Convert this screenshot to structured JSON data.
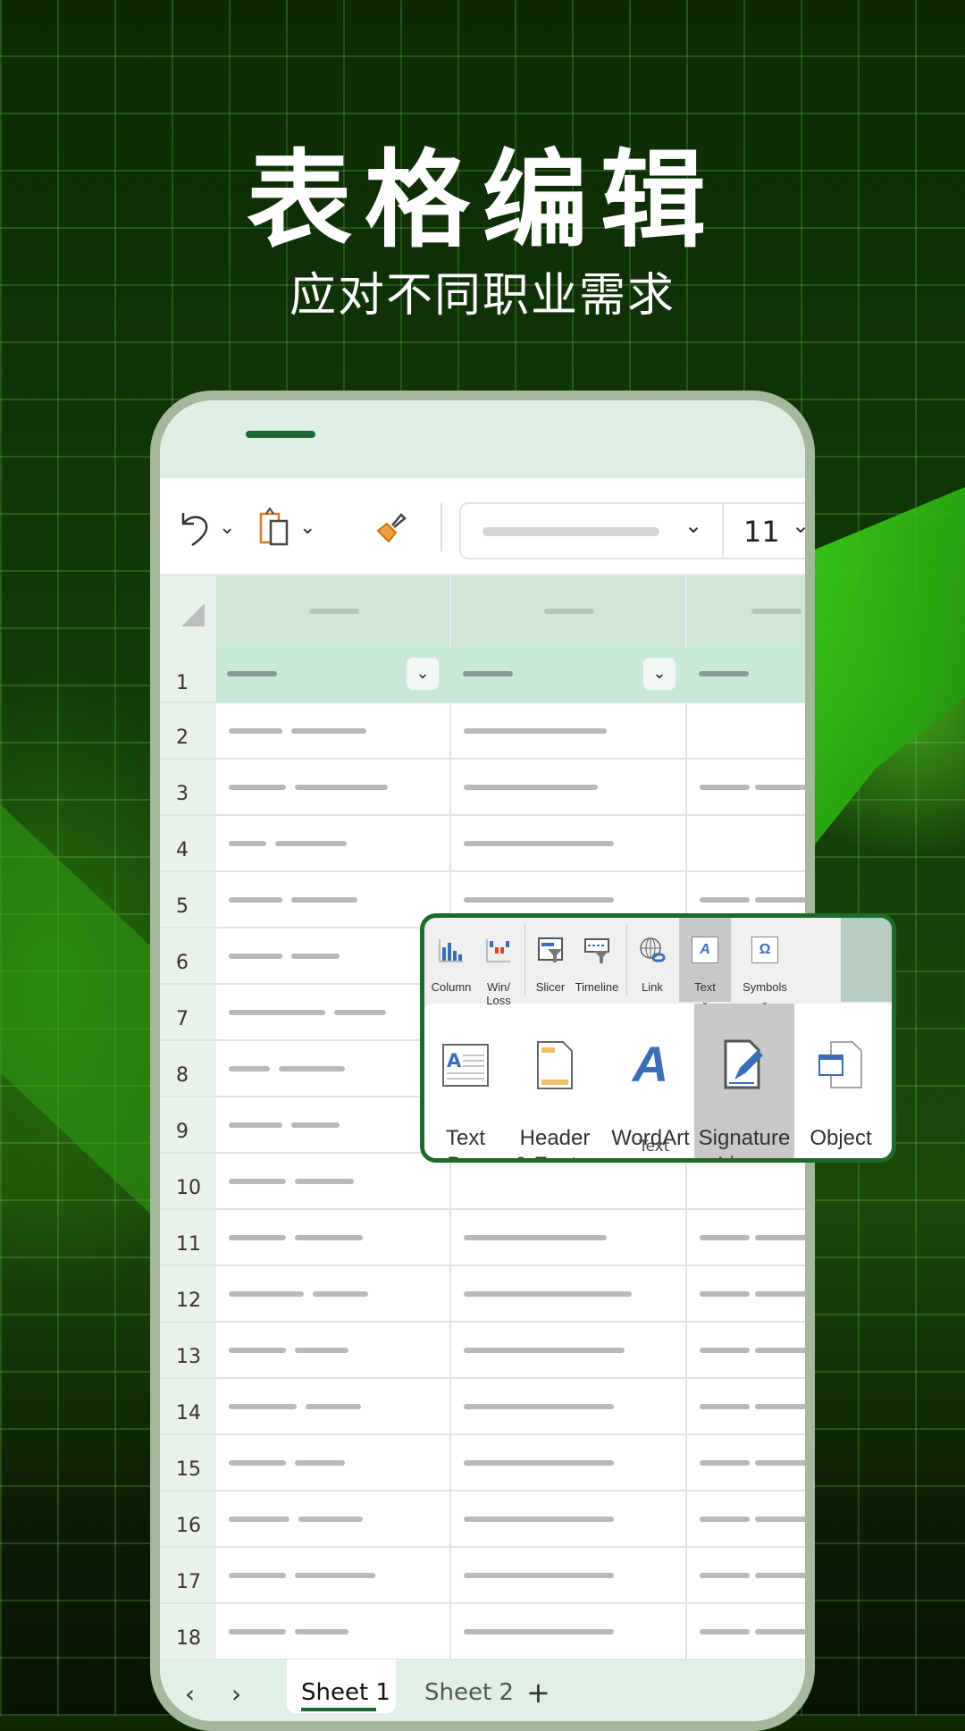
{
  "headline": {
    "title": "表格编辑",
    "subtitle": "应对不同职业需求"
  },
  "colors": {
    "accent": "#1b6a35",
    "background": "#123b08",
    "header_row": "#c9e8d5",
    "highlight": "#c8c8c8"
  },
  "toolbar": {
    "undo_icon": "undo-icon",
    "paste_icon": "clipboard-icon",
    "format_painter_icon": "paintbrush-icon",
    "font_size": "11"
  },
  "sheet": {
    "row_numbers": [
      "1",
      "2",
      "3",
      "4",
      "5",
      "6",
      "7",
      "8",
      "9",
      "10",
      "11",
      "12",
      "13",
      "14",
      "15",
      "16",
      "17",
      "18"
    ]
  },
  "tabs": {
    "prev_icon": "chevron-left-icon",
    "next_icon": "chevron-right-icon",
    "items": [
      {
        "label": "Sheet 1",
        "active": true
      },
      {
        "label": "Sheet 2",
        "active": false
      }
    ],
    "add": "+"
  },
  "ribbon": {
    "top_items": [
      {
        "label": "Column"
      },
      {
        "label": "Win/\nLoss"
      },
      {
        "label": "Slicer"
      },
      {
        "label": "Timeline"
      },
      {
        "label": "Link"
      },
      {
        "label": "Text",
        "active": true
      },
      {
        "label": "Symbols"
      }
    ],
    "text_group": {
      "label": "Text",
      "items": [
        {
          "label": "Text\nBox"
        },
        {
          "label": "Header\n& Footer"
        },
        {
          "label": "WordArt",
          "chevron": "˅"
        },
        {
          "label": "Signature\nLine˅",
          "active": true
        },
        {
          "label": "Object"
        }
      ]
    }
  }
}
